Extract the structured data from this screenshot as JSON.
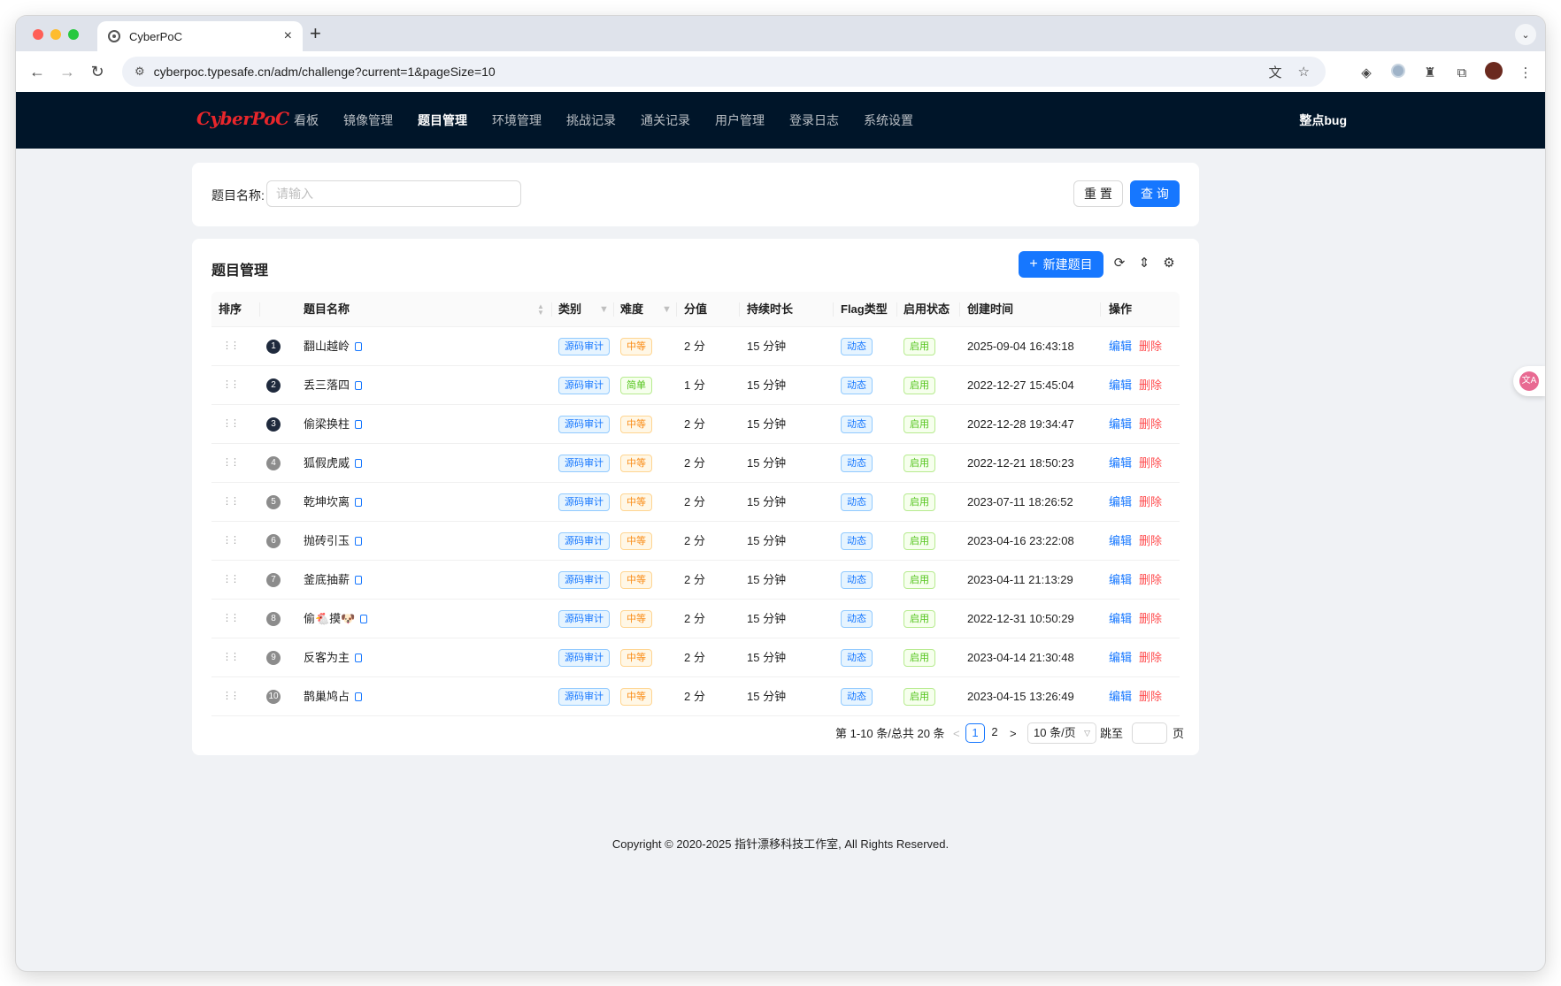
{
  "browser": {
    "tab_title": "CyberPoC",
    "tab_close": "×",
    "new_tab": "+",
    "url": "cyberpoc.typesafe.cn/adm/challenge?current=1&pageSize=10"
  },
  "app": {
    "logo": "CyberPoC",
    "nav": [
      "看板",
      "镜像管理",
      "题目管理",
      "环境管理",
      "挑战记录",
      "通关记录",
      "用户管理",
      "登录日志",
      "系统设置"
    ],
    "active_nav": "题目管理",
    "user": "整点bug"
  },
  "search": {
    "label": "题目名称:",
    "placeholder": "请输入",
    "reset_label": "重 置",
    "query_label": "查 询"
  },
  "table": {
    "title": "题目管理",
    "new_button": "新建题目",
    "columns": {
      "sort": "排序",
      "name": "题目名称",
      "category": "类别",
      "difficulty": "难度",
      "score": "分值",
      "duration": "持续时长",
      "flag_type": "Flag类型",
      "status": "启用状态",
      "created": "创建时间",
      "actions": "操作"
    },
    "rows": [
      {
        "index": "1",
        "name": "翻山越岭",
        "category": "源码审计",
        "difficulty": "中等",
        "score": "2 分",
        "duration": "15 分钟",
        "flag_type": "动态",
        "status": "启用",
        "created": "2025-09-04 16:43:18"
      },
      {
        "index": "2",
        "name": "丢三落四",
        "category": "源码审计",
        "difficulty": "简单",
        "score": "1 分",
        "duration": "15 分钟",
        "flag_type": "动态",
        "status": "启用",
        "created": "2022-12-27 15:45:04"
      },
      {
        "index": "3",
        "name": "偷梁换柱",
        "category": "源码审计",
        "difficulty": "中等",
        "score": "2 分",
        "duration": "15 分钟",
        "flag_type": "动态",
        "status": "启用",
        "created": "2022-12-28 19:34:47"
      },
      {
        "index": "4",
        "name": "狐假虎威",
        "category": "源码审计",
        "difficulty": "中等",
        "score": "2 分",
        "duration": "15 分钟",
        "flag_type": "动态",
        "status": "启用",
        "created": "2022-12-21 18:50:23"
      },
      {
        "index": "5",
        "name": "乾坤坎离",
        "category": "源码审计",
        "difficulty": "中等",
        "score": "2 分",
        "duration": "15 分钟",
        "flag_type": "动态",
        "status": "启用",
        "created": "2023-07-11 18:26:52"
      },
      {
        "index": "6",
        "name": "抛砖引玉",
        "category": "源码审计",
        "difficulty": "中等",
        "score": "2 分",
        "duration": "15 分钟",
        "flag_type": "动态",
        "status": "启用",
        "created": "2023-04-16 23:22:08"
      },
      {
        "index": "7",
        "name": "釜底抽薪",
        "category": "源码审计",
        "difficulty": "中等",
        "score": "2 分",
        "duration": "15 分钟",
        "flag_type": "动态",
        "status": "启用",
        "created": "2023-04-11 21:13:29"
      },
      {
        "index": "8",
        "name": "偷🐔摸🐶",
        "category": "源码审计",
        "difficulty": "中等",
        "score": "2 分",
        "duration": "15 分钟",
        "flag_type": "动态",
        "status": "启用",
        "created": "2022-12-31 10:50:29"
      },
      {
        "index": "9",
        "name": "反客为主",
        "category": "源码审计",
        "difficulty": "中等",
        "score": "2 分",
        "duration": "15 分钟",
        "flag_type": "动态",
        "status": "启用",
        "created": "2023-04-14 21:30:48"
      },
      {
        "index": "10",
        "name": "鹊巢鸠占",
        "category": "源码审计",
        "difficulty": "中等",
        "score": "2 分",
        "duration": "15 分钟",
        "flag_type": "动态",
        "status": "启用",
        "created": "2023-04-15 13:26:49"
      }
    ],
    "edit_label": "编辑",
    "delete_label": "删除"
  },
  "pagination": {
    "summary": "第 1-10 条/总共 20 条",
    "prev": "<",
    "next": ">",
    "pages": [
      "1",
      "2"
    ],
    "current": "1",
    "page_size": "10 条/页",
    "jump_prefix": "跳至",
    "jump_suffix": "页"
  },
  "footer": "Copyright © 2020-2025 指针漂移科技工作室, All Rights Reserved.",
  "colors": {
    "primary": "#1677ff",
    "danger": "#ff4d4f",
    "header_bg": "#001529",
    "logo": "#e8262b"
  }
}
